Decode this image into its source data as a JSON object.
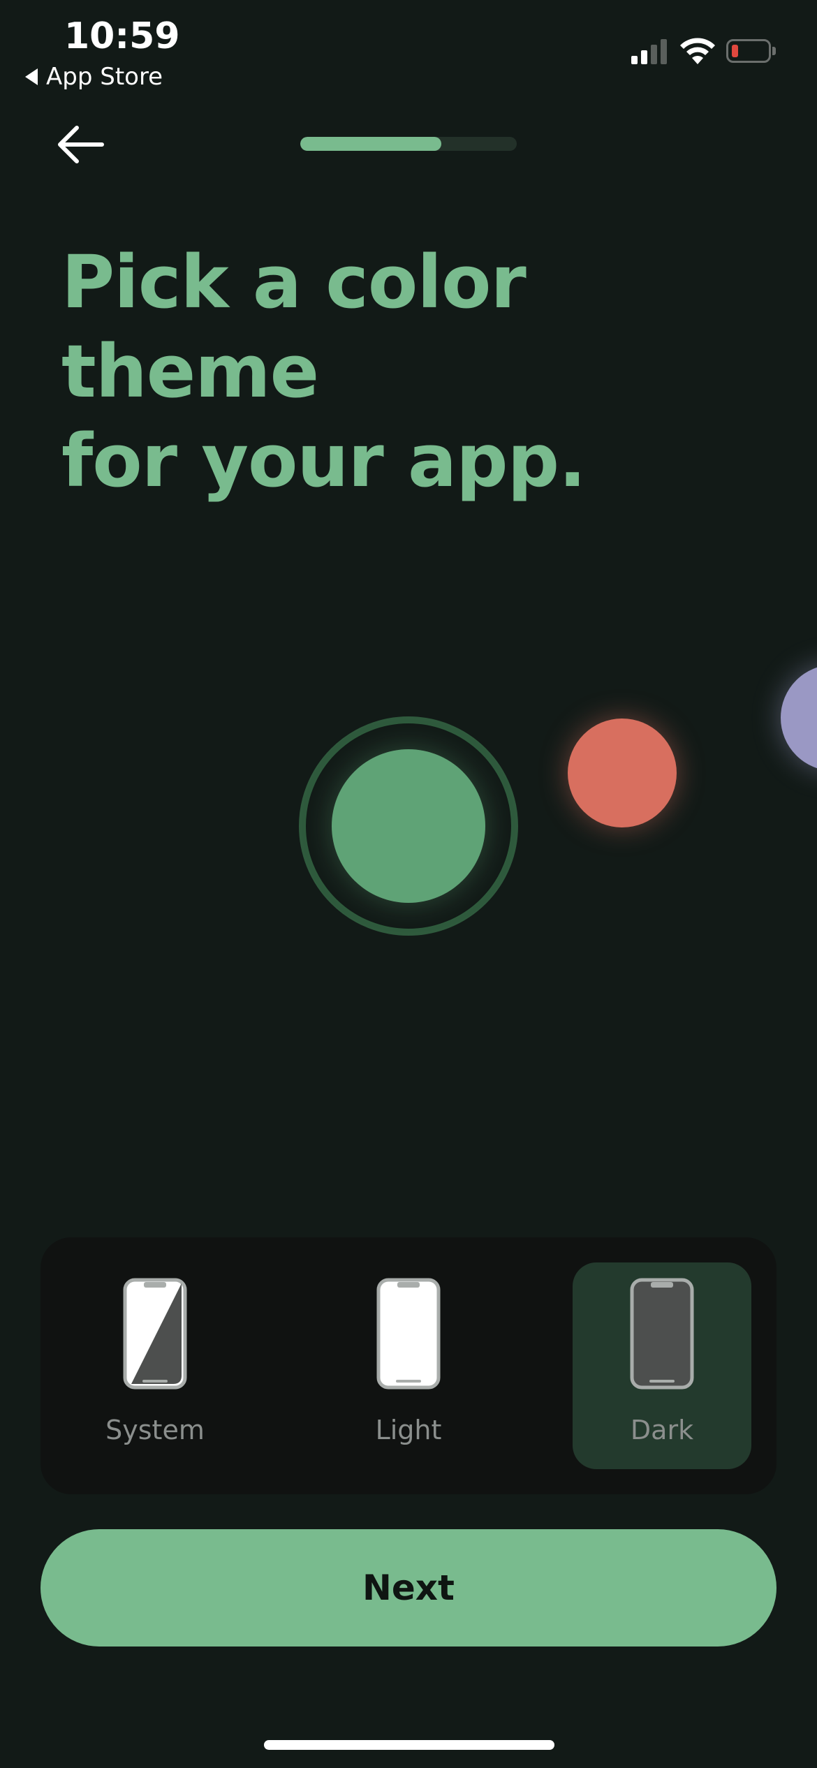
{
  "status_bar": {
    "time": "10:59",
    "back_app": "App Store",
    "battery_color": "#e0483e"
  },
  "nav": {
    "back_icon": "arrow-left-icon",
    "progress_fraction": 0.65
  },
  "title": {
    "line1": "Pick a color theme",
    "line2": "for your app."
  },
  "color_options": [
    {
      "name": "green",
      "color": "#5fa376",
      "selected": true
    },
    {
      "name": "coral",
      "color": "#d86f5f",
      "selected": false
    },
    {
      "name": "lavender",
      "color": "#9a98c4",
      "selected": false
    }
  ],
  "theme_options": [
    {
      "label": "System",
      "icon": "phone-system-icon",
      "selected": false
    },
    {
      "label": "Light",
      "icon": "phone-light-icon",
      "selected": false
    },
    {
      "label": "Dark",
      "icon": "phone-dark-icon",
      "selected": true
    }
  ],
  "next_button": {
    "label": "Next"
  },
  "colors": {
    "accent": "#79bb8e",
    "background": "#121a17",
    "selected_tile": "#233a2d"
  }
}
